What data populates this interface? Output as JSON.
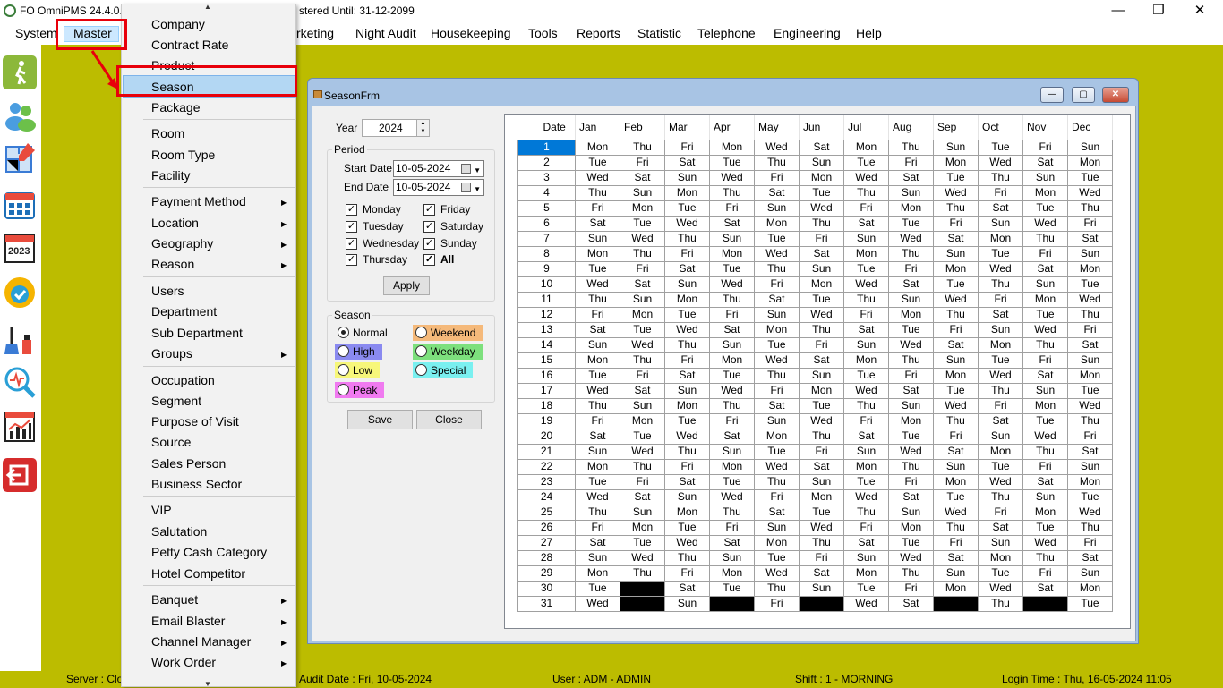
{
  "app": {
    "title_left": "FO OmniPMS 24.4.0.(",
    "title_right": "stered Until: 31-12-2099",
    "window_controls": [
      "minimize-icon",
      "restore-icon",
      "close-icon"
    ]
  },
  "menubar": {
    "items": [
      "System",
      "Master",
      "rketing",
      "Night Audit",
      "Housekeeping",
      "Tools",
      "Reports",
      "Statistic",
      "Telephone",
      "Engineering",
      "Help"
    ]
  },
  "toolbar": {
    "icons": [
      "walk-in-icon",
      "guests-icon",
      "room-plan-icon",
      "reservation-calendar-icon",
      "calendar-2023-icon",
      "availability-icon",
      "housekeeping-icon",
      "search-analysis-icon",
      "report-chart-icon",
      "exit-icon"
    ]
  },
  "master_menu": {
    "items": [
      {
        "label": "Company",
        "sub": false
      },
      {
        "label": "Contract Rate",
        "sub": false
      },
      {
        "label": "Product",
        "sub": false
      },
      {
        "label": "Season",
        "sub": false,
        "selected": true
      },
      {
        "label": "Package",
        "sub": false
      },
      {
        "label": "Room",
        "sub": false
      },
      {
        "label": "Room Type",
        "sub": false
      },
      {
        "label": "Facility",
        "sub": false
      },
      {
        "label": "Payment Method",
        "sub": true
      },
      {
        "label": "Location",
        "sub": true
      },
      {
        "label": "Geography",
        "sub": true
      },
      {
        "label": "Reason",
        "sub": true
      },
      {
        "label": "Users",
        "sub": false
      },
      {
        "label": "Department",
        "sub": false
      },
      {
        "label": "Sub Department",
        "sub": false
      },
      {
        "label": "Groups",
        "sub": true
      },
      {
        "label": "Occupation",
        "sub": false
      },
      {
        "label": "Segment",
        "sub": false
      },
      {
        "label": "Purpose of Visit",
        "sub": false
      },
      {
        "label": "Source",
        "sub": false
      },
      {
        "label": "Sales Person",
        "sub": false
      },
      {
        "label": "Business Sector",
        "sub": false
      },
      {
        "label": "VIP",
        "sub": false
      },
      {
        "label": "Salutation",
        "sub": false
      },
      {
        "label": "Petty Cash Category",
        "sub": false
      },
      {
        "label": "Hotel Competitor",
        "sub": false
      },
      {
        "label": "Banquet",
        "sub": true
      },
      {
        "label": "Email Blaster",
        "sub": true
      },
      {
        "label": "Channel Manager",
        "sub": true
      },
      {
        "label": "Work Order",
        "sub": true
      }
    ]
  },
  "status": {
    "server": "Server : Clo",
    "audit": "Audit Date : Fri, 10-05-2024",
    "user": "User : ADM - ADMIN",
    "shift": "Shift : 1 - MORNING",
    "login": "Login Time : Thu, 16-05-2024 11:05"
  },
  "season_form": {
    "title": "SeasonFrm",
    "year_label": "Year",
    "year_value": "2024",
    "period_label": "Period",
    "start_label": "Start Date",
    "start_value": "10-05-2024",
    "end_label": "End Date",
    "end_value": "10-05-2024",
    "days": [
      {
        "label": "Monday",
        "checked": true
      },
      {
        "label": "Friday",
        "checked": true
      },
      {
        "label": "Tuesday",
        "checked": true
      },
      {
        "label": "Saturday",
        "checked": true
      },
      {
        "label": "Wednesday",
        "checked": true
      },
      {
        "label": "Sunday",
        "checked": true
      },
      {
        "label": "Thursday",
        "checked": true
      },
      {
        "label": "All",
        "checked": true
      }
    ],
    "apply_label": "Apply",
    "season_label": "Season",
    "seasons": [
      {
        "label": "Normal",
        "color": "#f0f0f0",
        "checked": true
      },
      {
        "label": "Weekend",
        "color": "#f5b97a",
        "checked": false
      },
      {
        "label": "High",
        "color": "#8a8af0",
        "checked": false
      },
      {
        "label": "Weekday",
        "color": "#7de07d",
        "checked": false
      },
      {
        "label": "Low",
        "color": "#f7f77a",
        "checked": false
      },
      {
        "label": "Special",
        "color": "#7af0f0",
        "checked": false
      },
      {
        "label": "Peak",
        "color": "#f07af0",
        "checked": false
      }
    ],
    "save_label": "Save",
    "close_label": "Close",
    "selected_color": "#0078d7"
  },
  "calendar": {
    "headers": [
      "Date",
      "Jan",
      "Feb",
      "Mar",
      "Apr",
      "May",
      "Jun",
      "Jul",
      "Aug",
      "Sep",
      "Oct",
      "Nov",
      "Dec"
    ],
    "rows": [
      [
        "1",
        "Mon",
        "Thu",
        "Fri",
        "Mon",
        "Wed",
        "Sat",
        "Mon",
        "Thu",
        "Sun",
        "Tue",
        "Fri",
        "Sun"
      ],
      [
        "2",
        "Tue",
        "Fri",
        "Sat",
        "Tue",
        "Thu",
        "Sun",
        "Tue",
        "Fri",
        "Mon",
        "Wed",
        "Sat",
        "Mon"
      ],
      [
        "3",
        "Wed",
        "Sat",
        "Sun",
        "Wed",
        "Fri",
        "Mon",
        "Wed",
        "Sat",
        "Tue",
        "Thu",
        "Sun",
        "Tue"
      ],
      [
        "4",
        "Thu",
        "Sun",
        "Mon",
        "Thu",
        "Sat",
        "Tue",
        "Thu",
        "Sun",
        "Wed",
        "Fri",
        "Mon",
        "Wed"
      ],
      [
        "5",
        "Fri",
        "Mon",
        "Tue",
        "Fri",
        "Sun",
        "Wed",
        "Fri",
        "Mon",
        "Thu",
        "Sat",
        "Tue",
        "Thu"
      ],
      [
        "6",
        "Sat",
        "Tue",
        "Wed",
        "Sat",
        "Mon",
        "Thu",
        "Sat",
        "Tue",
        "Fri",
        "Sun",
        "Wed",
        "Fri"
      ],
      [
        "7",
        "Sun",
        "Wed",
        "Thu",
        "Sun",
        "Tue",
        "Fri",
        "Sun",
        "Wed",
        "Sat",
        "Mon",
        "Thu",
        "Sat"
      ],
      [
        "8",
        "Mon",
        "Thu",
        "Fri",
        "Mon",
        "Wed",
        "Sat",
        "Mon",
        "Thu",
        "Sun",
        "Tue",
        "Fri",
        "Sun"
      ],
      [
        "9",
        "Tue",
        "Fri",
        "Sat",
        "Tue",
        "Thu",
        "Sun",
        "Tue",
        "Fri",
        "Mon",
        "Wed",
        "Sat",
        "Mon"
      ],
      [
        "10",
        "Wed",
        "Sat",
        "Sun",
        "Wed",
        "Fri",
        "Mon",
        "Wed",
        "Sat",
        "Tue",
        "Thu",
        "Sun",
        "Tue"
      ],
      [
        "11",
        "Thu",
        "Sun",
        "Mon",
        "Thu",
        "Sat",
        "Tue",
        "Thu",
        "Sun",
        "Wed",
        "Fri",
        "Mon",
        "Wed"
      ],
      [
        "12",
        "Fri",
        "Mon",
        "Tue",
        "Fri",
        "Sun",
        "Wed",
        "Fri",
        "Mon",
        "Thu",
        "Sat",
        "Tue",
        "Thu"
      ],
      [
        "13",
        "Sat",
        "Tue",
        "Wed",
        "Sat",
        "Mon",
        "Thu",
        "Sat",
        "Tue",
        "Fri",
        "Sun",
        "Wed",
        "Fri"
      ],
      [
        "14",
        "Sun",
        "Wed",
        "Thu",
        "Sun",
        "Tue",
        "Fri",
        "Sun",
        "Wed",
        "Sat",
        "Mon",
        "Thu",
        "Sat"
      ],
      [
        "15",
        "Mon",
        "Thu",
        "Fri",
        "Mon",
        "Wed",
        "Sat",
        "Mon",
        "Thu",
        "Sun",
        "Tue",
        "Fri",
        "Sun"
      ],
      [
        "16",
        "Tue",
        "Fri",
        "Sat",
        "Tue",
        "Thu",
        "Sun",
        "Tue",
        "Fri",
        "Mon",
        "Wed",
        "Sat",
        "Mon"
      ],
      [
        "17",
        "Wed",
        "Sat",
        "Sun",
        "Wed",
        "Fri",
        "Mon",
        "Wed",
        "Sat",
        "Tue",
        "Thu",
        "Sun",
        "Tue"
      ],
      [
        "18",
        "Thu",
        "Sun",
        "Mon",
        "Thu",
        "Sat",
        "Tue",
        "Thu",
        "Sun",
        "Wed",
        "Fri",
        "Mon",
        "Wed"
      ],
      [
        "19",
        "Fri",
        "Mon",
        "Tue",
        "Fri",
        "Sun",
        "Wed",
        "Fri",
        "Mon",
        "Thu",
        "Sat",
        "Tue",
        "Thu"
      ],
      [
        "20",
        "Sat",
        "Tue",
        "Wed",
        "Sat",
        "Mon",
        "Thu",
        "Sat",
        "Tue",
        "Fri",
        "Sun",
        "Wed",
        "Fri"
      ],
      [
        "21",
        "Sun",
        "Wed",
        "Thu",
        "Sun",
        "Tue",
        "Fri",
        "Sun",
        "Wed",
        "Sat",
        "Mon",
        "Thu",
        "Sat"
      ],
      [
        "22",
        "Mon",
        "Thu",
        "Fri",
        "Mon",
        "Wed",
        "Sat",
        "Mon",
        "Thu",
        "Sun",
        "Tue",
        "Fri",
        "Sun"
      ],
      [
        "23",
        "Tue",
        "Fri",
        "Sat",
        "Tue",
        "Thu",
        "Sun",
        "Tue",
        "Fri",
        "Mon",
        "Wed",
        "Sat",
        "Mon"
      ],
      [
        "24",
        "Wed",
        "Sat",
        "Sun",
        "Wed",
        "Fri",
        "Mon",
        "Wed",
        "Sat",
        "Tue",
        "Thu",
        "Sun",
        "Tue"
      ],
      [
        "25",
        "Thu",
        "Sun",
        "Mon",
        "Thu",
        "Sat",
        "Tue",
        "Thu",
        "Sun",
        "Wed",
        "Fri",
        "Mon",
        "Wed"
      ],
      [
        "26",
        "Fri",
        "Mon",
        "Tue",
        "Fri",
        "Sun",
        "Wed",
        "Fri",
        "Mon",
        "Thu",
        "Sat",
        "Tue",
        "Thu"
      ],
      [
        "27",
        "Sat",
        "Tue",
        "Wed",
        "Sat",
        "Mon",
        "Thu",
        "Sat",
        "Tue",
        "Fri",
        "Sun",
        "Wed",
        "Fri"
      ],
      [
        "28",
        "Sun",
        "Wed",
        "Thu",
        "Sun",
        "Tue",
        "Fri",
        "Sun",
        "Wed",
        "Sat",
        "Mon",
        "Thu",
        "Sat"
      ],
      [
        "29",
        "Mon",
        "Thu",
        "Fri",
        "Mon",
        "Wed",
        "Sat",
        "Mon",
        "Thu",
        "Sun",
        "Tue",
        "Fri",
        "Sun"
      ],
      [
        "30",
        "Tue",
        "",
        "Sat",
        "Tue",
        "Thu",
        "Sun",
        "Tue",
        "Fri",
        "Mon",
        "Wed",
        "Sat",
        "Mon"
      ],
      [
        "31",
        "Wed",
        "",
        "Sun",
        "",
        "Fri",
        "",
        "Wed",
        "Sat",
        "",
        "Thu",
        "",
        "Tue"
      ]
    ]
  }
}
